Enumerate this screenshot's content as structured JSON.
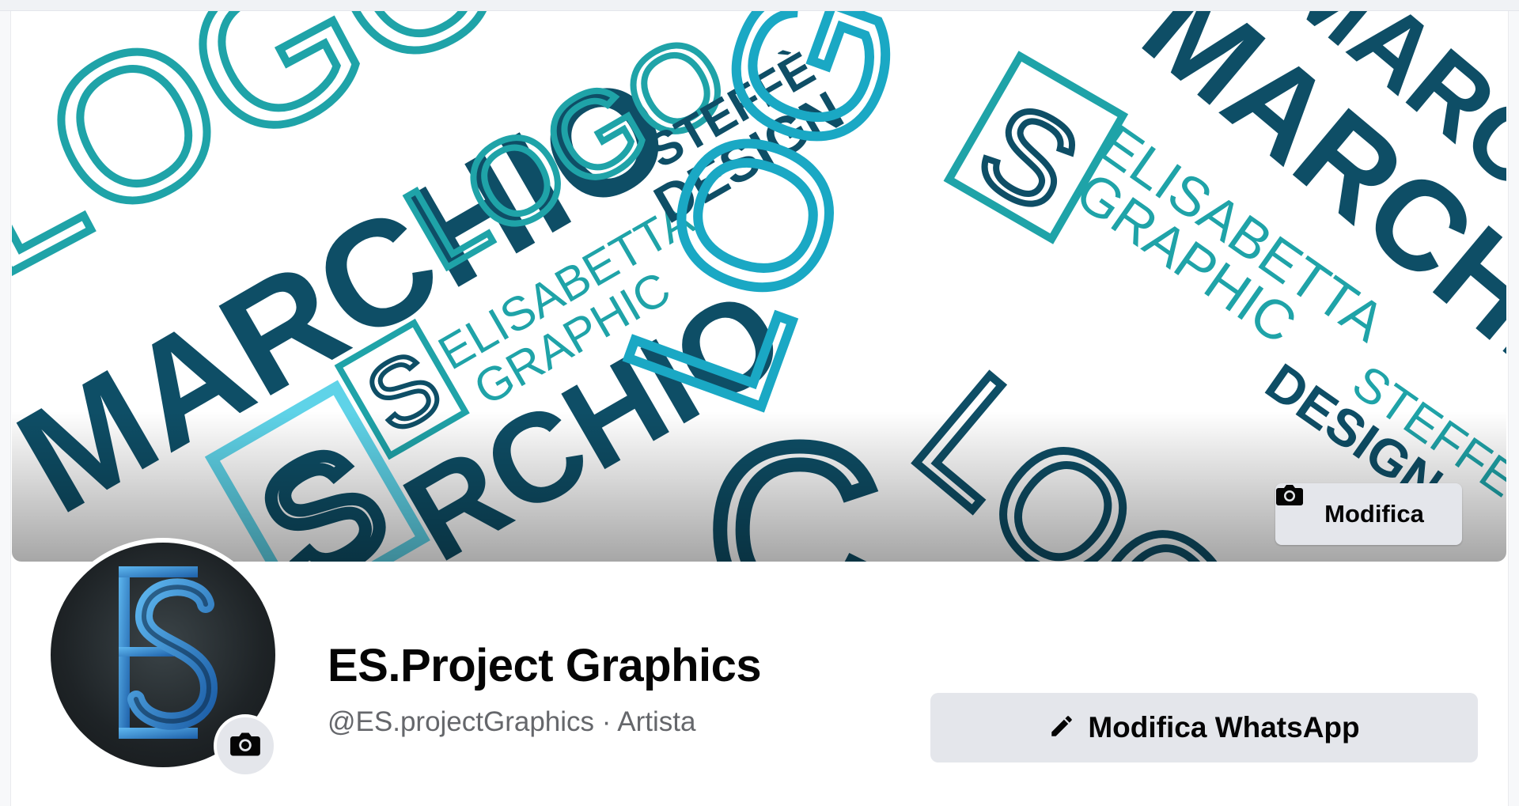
{
  "cover": {
    "edit_label": "Modifica",
    "edit_icon": "camera-icon",
    "artwork_words": [
      "MARCHIO",
      "LOGO",
      "ELISABETTA STEFFÈ",
      "GRAPHIC DESIGN",
      "ES"
    ]
  },
  "profile": {
    "name": "ES.Project Graphics",
    "subtitle": "@ES.projectGraphics · Artista",
    "avatar_monogram": "ES",
    "avatar_camera_icon": "camera-icon"
  },
  "actions": {
    "whatsapp_label": "Modifica WhatsApp",
    "whatsapp_icon": "pencil-icon"
  },
  "colors": {
    "teal": "#1fa3a8",
    "dark_teal": "#0e4e66",
    "light_cyan": "#5fd3e8",
    "button_bg": "#e4e6eb",
    "subtitle_gray": "#65676b"
  }
}
